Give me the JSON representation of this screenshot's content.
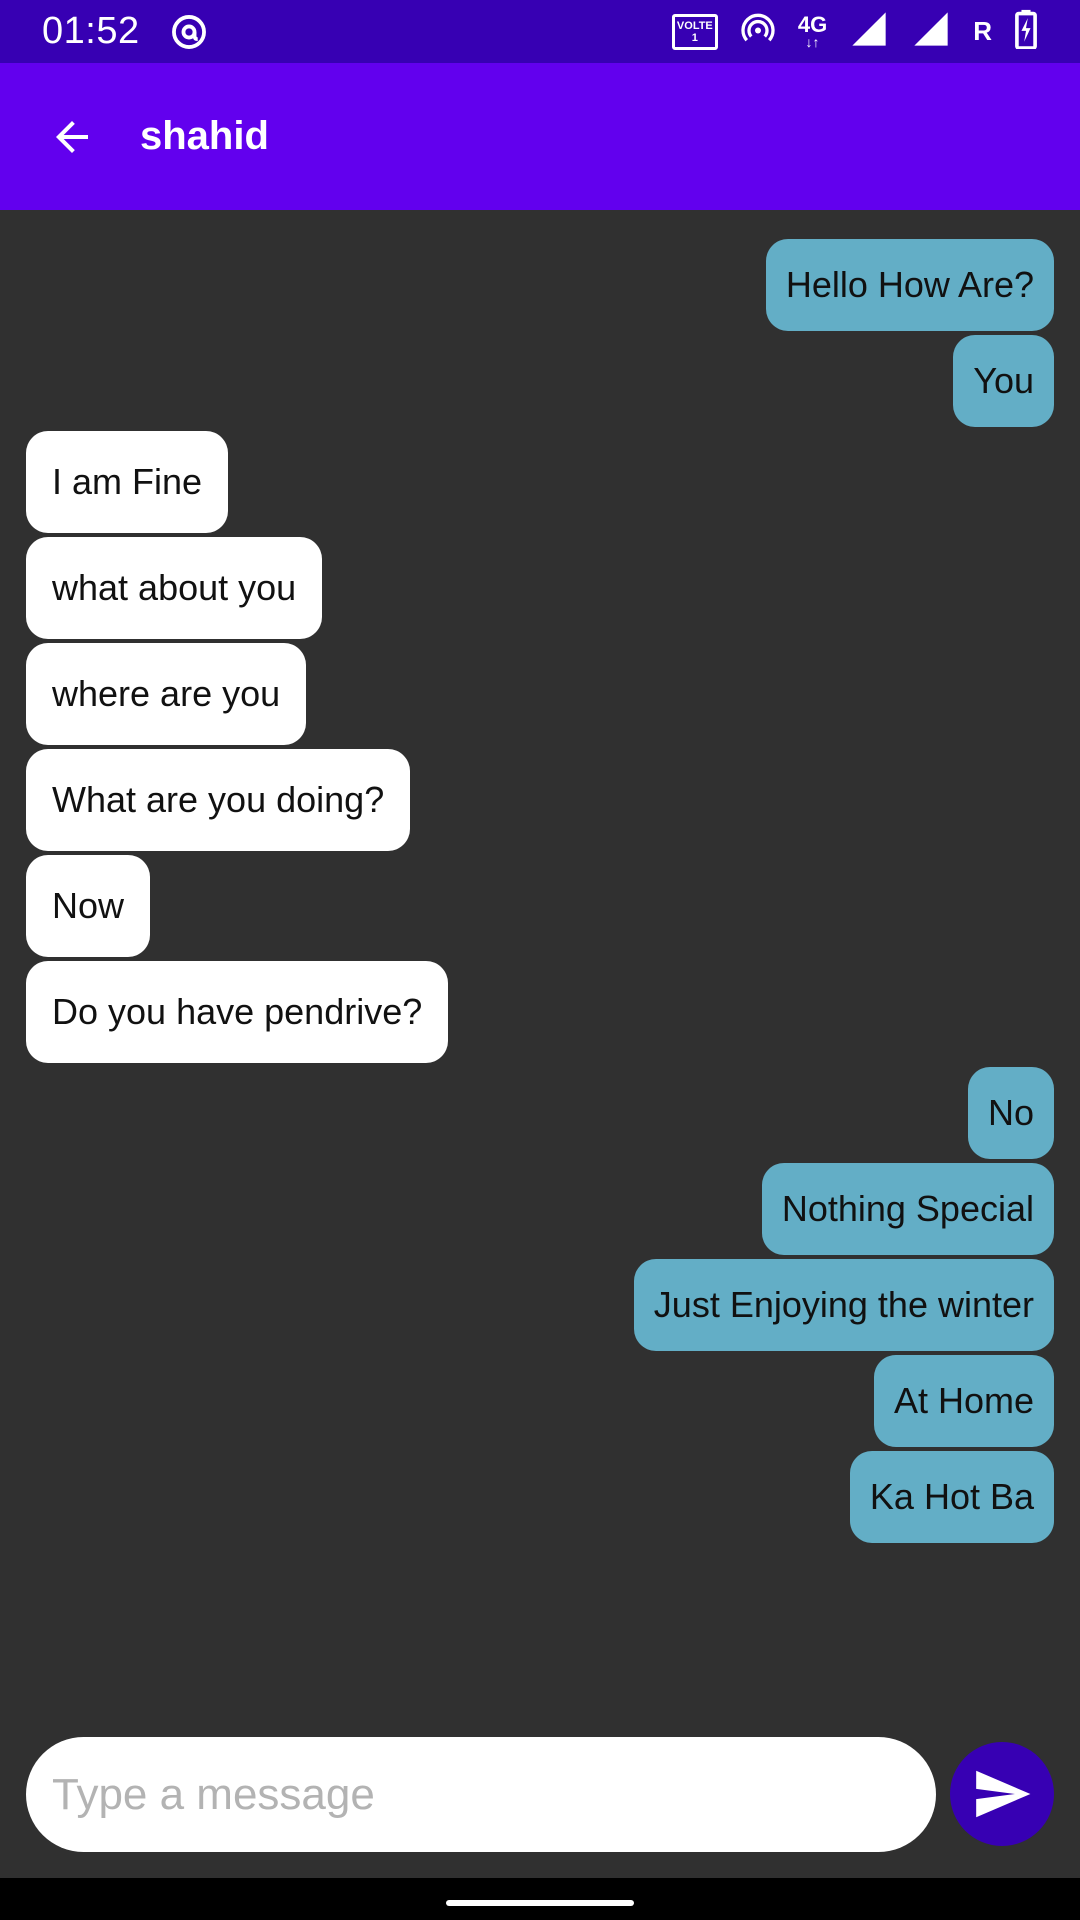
{
  "status_bar": {
    "time": "01:52",
    "volte_label": "VOLTE",
    "sim_number": "1",
    "network_type": "4G",
    "roaming": "R",
    "icons": [
      "at-sign-icon",
      "hotspot-icon",
      "signal-icon",
      "signal-icon",
      "battery-charging-icon"
    ]
  },
  "app_bar": {
    "back_icon": "arrow-back-icon",
    "title": "shahid",
    "color": "#6200ee"
  },
  "messages": [
    {
      "direction": "out",
      "text": "Hello How Are?"
    },
    {
      "direction": "out",
      "text": "You"
    },
    {
      "direction": "in",
      "text": "I am Fine"
    },
    {
      "direction": "in",
      "text": "what about you"
    },
    {
      "direction": "in",
      "text": "where are you"
    },
    {
      "direction": "in",
      "text": "What are you doing?"
    },
    {
      "direction": "in",
      "text": "Now"
    },
    {
      "direction": "in",
      "text": "Do you have pendrive?"
    },
    {
      "direction": "out",
      "text": "No"
    },
    {
      "direction": "out",
      "text": "Nothing Special"
    },
    {
      "direction": "out",
      "text": "Just Enjoying the winter"
    },
    {
      "direction": "out",
      "text": "At Home"
    },
    {
      "direction": "out",
      "text": "Ka Hot Ba"
    }
  ],
  "composer": {
    "placeholder": "Type a message",
    "value": "",
    "send_icon": "send-icon"
  },
  "colors": {
    "status_bar": "#3700b3",
    "app_bar": "#6200ee",
    "background": "#303030",
    "outgoing_bubble": "#63aec6",
    "incoming_bubble": "#ffffff",
    "send_button": "#3700b3"
  }
}
